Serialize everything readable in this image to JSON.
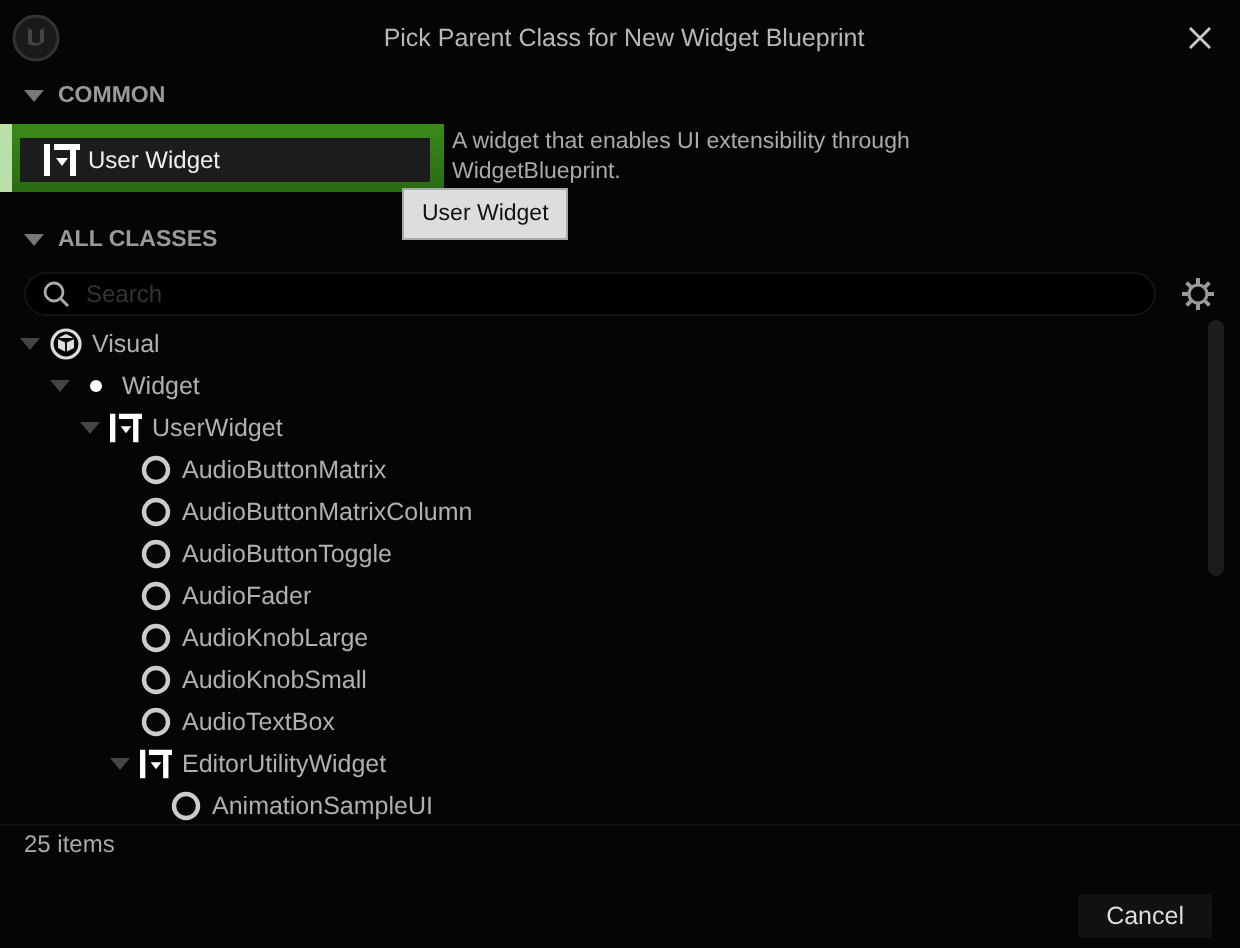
{
  "window": {
    "title": "Pick Parent Class for New Widget Blueprint"
  },
  "common": {
    "label": "COMMON",
    "expanded": true,
    "items": [
      {
        "label": "User Widget",
        "selected": true,
        "description": "A widget that enables UI extensibility through WidgetBlueprint.",
        "tooltip": "User Widget"
      }
    ]
  },
  "all_classes": {
    "label": "ALL CLASSES",
    "expanded": true,
    "search": {
      "placeholder": "Search"
    },
    "tree": [
      {
        "label": "Visual",
        "kind": "visual",
        "expanded": true,
        "children": [
          {
            "label": "Widget",
            "kind": "widget",
            "expanded": true,
            "children": [
              {
                "label": "UserWidget",
                "kind": "user-widget",
                "expanded": true,
                "children": [
                  {
                    "label": "AudioButtonMatrix",
                    "kind": "class"
                  },
                  {
                    "label": "AudioButtonMatrixColumn",
                    "kind": "class"
                  },
                  {
                    "label": "AudioButtonToggle",
                    "kind": "class"
                  },
                  {
                    "label": "AudioFader",
                    "kind": "class"
                  },
                  {
                    "label": "AudioKnobLarge",
                    "kind": "class"
                  },
                  {
                    "label": "AudioKnobSmall",
                    "kind": "class"
                  },
                  {
                    "label": "AudioTextBox",
                    "kind": "class"
                  },
                  {
                    "label": "EditorUtilityWidget",
                    "kind": "user-widget",
                    "expanded": true,
                    "children": [
                      {
                        "label": "AnimationSampleUI",
                        "kind": "class"
                      }
                    ]
                  }
                ]
              }
            ]
          }
        ]
      }
    ]
  },
  "status_bar": {
    "count": "25 items"
  },
  "buttons": [
    "Cancel"
  ]
}
